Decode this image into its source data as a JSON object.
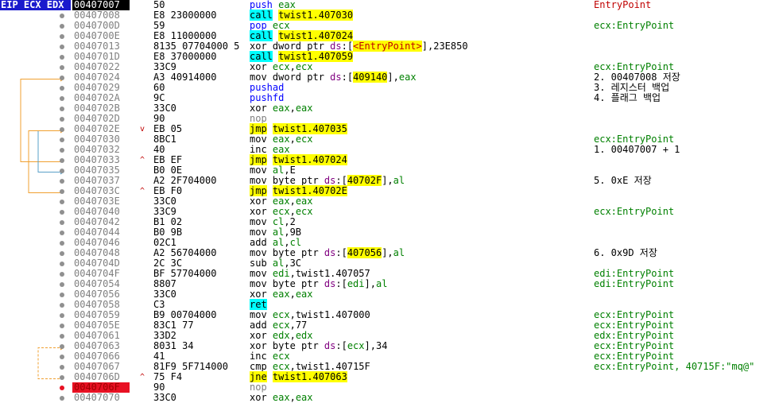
{
  "registers_label": "EIP ECX EDX",
  "colors": {
    "call_bg": "#00ffff",
    "jmp_bg": "#ffff00",
    "cur_reg_bg": "#1a1acd",
    "breakpoint": "#e81123",
    "reg_text": "#008000",
    "seg_text": "#800080",
    "jump_line": "#f0a030",
    "jump_line_sel": "#5aa0c8"
  },
  "rows": [
    {
      "addr": "00407007",
      "bytes": "50",
      "mark": "",
      "dot": false,
      "cur": true,
      "bp": false,
      "asm": [
        [
          "mn-push",
          "push "
        ],
        [
          "reg",
          "eax"
        ]
      ],
      "cmt": [
        [
          "p",
          "EntryPoint"
        ]
      ]
    },
    {
      "addr": "00407008",
      "bytes": "E8 23000000",
      "mark": "",
      "dot": true,
      "asm": [
        [
          "mn-call",
          "call"
        ],
        [
          "kw",
          " "
        ],
        [
          "mn-jmp",
          "twist1.407030"
        ]
      ],
      "cmt": []
    },
    {
      "addr": "0040700D",
      "bytes": "59",
      "mark": "",
      "dot": true,
      "asm": [
        [
          "mn-pop",
          "pop "
        ],
        [
          "reg",
          "ecx"
        ]
      ],
      "cmt": [
        [
          "r",
          "ecx:EntryPoint"
        ]
      ]
    },
    {
      "addr": "0040700E",
      "bytes": "E8 11000000",
      "mark": "",
      "dot": true,
      "asm": [
        [
          "mn-call",
          "call"
        ],
        [
          "kw",
          " "
        ],
        [
          "mn-jmp",
          "twist1.407024"
        ]
      ],
      "cmt": []
    },
    {
      "addr": "00407013",
      "bytes": "8135 07704000 5",
      "mark": "",
      "dot": true,
      "asm": [
        [
          "kw",
          "xor dword ptr "
        ],
        [
          "seg",
          "ds"
        ],
        [
          "kw",
          ":["
        ],
        [
          "lbl",
          "<EntryPoint>"
        ],
        [
          "kw",
          "],23E850"
        ]
      ],
      "cmt": []
    },
    {
      "addr": "0040701D",
      "bytes": "E8 37000000",
      "mark": "",
      "dot": true,
      "asm": [
        [
          "mn-call",
          "call"
        ],
        [
          "kw",
          " "
        ],
        [
          "mn-jmp",
          "twist1.407059"
        ]
      ],
      "cmt": []
    },
    {
      "addr": "00407022",
      "bytes": "33C9",
      "mark": "",
      "dot": true,
      "asm": [
        [
          "kw",
          "xor "
        ],
        [
          "reg",
          "ecx"
        ],
        [
          "kw",
          ","
        ],
        [
          "reg",
          "ecx"
        ]
      ],
      "cmt": [
        [
          "r",
          "ecx:EntryPoint"
        ]
      ]
    },
    {
      "addr": "00407024",
      "bytes": "A3 40914000",
      "mark": "",
      "dot": true,
      "asm": [
        [
          "kw",
          "mov dword ptr "
        ],
        [
          "seg",
          "ds"
        ],
        [
          "kw",
          ":["
        ],
        [
          "mem",
          "409140"
        ],
        [
          "kw",
          "],"
        ],
        [
          "reg",
          "eax"
        ]
      ],
      "cmt": [
        [
          "kr",
          "2. 00407008 저장"
        ]
      ]
    },
    {
      "addr": "00407029",
      "bytes": "60",
      "mark": "",
      "dot": true,
      "asm": [
        [
          "mn-push",
          "pushad"
        ]
      ],
      "cmt": [
        [
          "kr",
          "3. 레지스터 백업"
        ]
      ]
    },
    {
      "addr": "0040702A",
      "bytes": "9C",
      "mark": "",
      "dot": true,
      "asm": [
        [
          "mn-push",
          "pushfd"
        ]
      ],
      "cmt": [
        [
          "kr",
          "4. 플래그 백업"
        ]
      ]
    },
    {
      "addr": "0040702B",
      "bytes": "33C0",
      "mark": "",
      "dot": true,
      "asm": [
        [
          "kw",
          "xor "
        ],
        [
          "reg",
          "eax"
        ],
        [
          "kw",
          ","
        ],
        [
          "reg",
          "eax"
        ]
      ],
      "cmt": []
    },
    {
      "addr": "0040702D",
      "bytes": "90",
      "mark": "",
      "dot": true,
      "asm": [
        [
          "mn-nop",
          "nop"
        ]
      ],
      "cmt": []
    },
    {
      "addr": "0040702E",
      "bytes": "EB 05",
      "mark": "v",
      "dot": true,
      "asm": [
        [
          "mn-jmp",
          "jmp"
        ],
        [
          "kw",
          " "
        ],
        [
          "mn-jmp",
          "twist1.407035"
        ]
      ],
      "cmt": []
    },
    {
      "addr": "00407030",
      "bytes": "8BC1",
      "mark": "",
      "dot": true,
      "asm": [
        [
          "kw",
          "mov "
        ],
        [
          "reg",
          "eax"
        ],
        [
          "kw",
          ","
        ],
        [
          "reg",
          "ecx"
        ]
      ],
      "cmt": [
        [
          "r",
          "ecx:EntryPoint"
        ]
      ]
    },
    {
      "addr": "00407032",
      "bytes": "40",
      "mark": "",
      "dot": true,
      "asm": [
        [
          "kw",
          "inc "
        ],
        [
          "reg",
          "eax"
        ]
      ],
      "cmt": [
        [
          "kr",
          "1. 00407007 + 1"
        ]
      ]
    },
    {
      "addr": "00407033",
      "bytes": "EB EF",
      "mark": "^",
      "dot": true,
      "asm": [
        [
          "mn-jmp",
          "jmp"
        ],
        [
          "kw",
          " "
        ],
        [
          "mn-jmp",
          "twist1.407024"
        ]
      ],
      "cmt": []
    },
    {
      "addr": "00407035",
      "bytes": "B0 0E",
      "mark": "",
      "dot": true,
      "asm": [
        [
          "kw",
          "mov "
        ],
        [
          "reg",
          "al"
        ],
        [
          "kw",
          ",E"
        ]
      ],
      "cmt": []
    },
    {
      "addr": "00407037",
      "bytes": "A2 2F704000",
      "mark": "",
      "dot": true,
      "asm": [
        [
          "kw",
          "mov byte ptr "
        ],
        [
          "seg",
          "ds"
        ],
        [
          "kw",
          ":["
        ],
        [
          "mem",
          "40702F"
        ],
        [
          "kw",
          "],"
        ],
        [
          "reg",
          "al"
        ]
      ],
      "cmt": [
        [
          "kr",
          "5. 0xE 저장"
        ]
      ]
    },
    {
      "addr": "0040703C",
      "bytes": "EB F0",
      "mark": "^",
      "dot": true,
      "asm": [
        [
          "mn-jmp",
          "jmp"
        ],
        [
          "kw",
          " "
        ],
        [
          "mn-jmp",
          "twist1.40702E"
        ]
      ],
      "cmt": []
    },
    {
      "addr": "0040703E",
      "bytes": "33C0",
      "mark": "",
      "dot": true,
      "asm": [
        [
          "kw",
          "xor "
        ],
        [
          "reg",
          "eax"
        ],
        [
          "kw",
          ","
        ],
        [
          "reg",
          "eax"
        ]
      ],
      "cmt": []
    },
    {
      "addr": "00407040",
      "bytes": "33C9",
      "mark": "",
      "dot": true,
      "asm": [
        [
          "kw",
          "xor "
        ],
        [
          "reg",
          "ecx"
        ],
        [
          "kw",
          ","
        ],
        [
          "reg",
          "ecx"
        ]
      ],
      "cmt": [
        [
          "r",
          "ecx:EntryPoint"
        ]
      ]
    },
    {
      "addr": "00407042",
      "bytes": "B1 02",
      "mark": "",
      "dot": true,
      "asm": [
        [
          "kw",
          "mov "
        ],
        [
          "reg",
          "cl"
        ],
        [
          "kw",
          ",2"
        ]
      ],
      "cmt": []
    },
    {
      "addr": "00407044",
      "bytes": "B0 9B",
      "mark": "",
      "dot": true,
      "asm": [
        [
          "kw",
          "mov "
        ],
        [
          "reg",
          "al"
        ],
        [
          "kw",
          ",9B"
        ]
      ],
      "cmt": []
    },
    {
      "addr": "00407046",
      "bytes": "02C1",
      "mark": "",
      "dot": true,
      "asm": [
        [
          "kw",
          "add "
        ],
        [
          "reg",
          "al"
        ],
        [
          "kw",
          ","
        ],
        [
          "reg",
          "cl"
        ]
      ],
      "cmt": []
    },
    {
      "addr": "00407048",
      "bytes": "A2 56704000",
      "mark": "",
      "dot": true,
      "asm": [
        [
          "kw",
          "mov byte ptr "
        ],
        [
          "seg",
          "ds"
        ],
        [
          "kw",
          ":["
        ],
        [
          "mem",
          "407056"
        ],
        [
          "kw",
          "],"
        ],
        [
          "reg",
          "al"
        ]
      ],
      "cmt": [
        [
          "kr",
          "6. 0x9D 저장"
        ]
      ]
    },
    {
      "addr": "0040704D",
      "bytes": "2C 3C",
      "mark": "",
      "dot": true,
      "asm": [
        [
          "kw",
          "sub "
        ],
        [
          "reg",
          "al"
        ],
        [
          "kw",
          ",3C"
        ]
      ],
      "cmt": []
    },
    {
      "addr": "0040704F",
      "bytes": "BF 57704000",
      "mark": "",
      "dot": true,
      "asm": [
        [
          "kw",
          "mov "
        ],
        [
          "reg",
          "edi"
        ],
        [
          "kw",
          ",twist1.407057"
        ]
      ],
      "cmt": [
        [
          "r",
          "edi:EntryPoint"
        ]
      ]
    },
    {
      "addr": "00407054",
      "bytes": "8807",
      "mark": "",
      "dot": true,
      "asm": [
        [
          "kw",
          "mov byte ptr "
        ],
        [
          "seg",
          "ds"
        ],
        [
          "kw",
          ":["
        ],
        [
          "reg",
          "edi"
        ],
        [
          "kw",
          "],"
        ],
        [
          "reg",
          "al"
        ]
      ],
      "cmt": [
        [
          "r",
          "edi:EntryPoint"
        ]
      ]
    },
    {
      "addr": "00407056",
      "bytes": "33C0",
      "mark": "",
      "dot": true,
      "asm": [
        [
          "kw",
          "xor "
        ],
        [
          "reg",
          "eax"
        ],
        [
          "kw",
          ","
        ],
        [
          "reg",
          "eax"
        ]
      ],
      "cmt": []
    },
    {
      "addr": "00407058",
      "bytes": "C3",
      "mark": "",
      "dot": true,
      "asm": [
        [
          "mn-ret",
          "ret"
        ]
      ],
      "cmt": []
    },
    {
      "addr": "00407059",
      "bytes": "B9 00704000",
      "mark": "",
      "dot": true,
      "asm": [
        [
          "kw",
          "mov "
        ],
        [
          "reg",
          "ecx"
        ],
        [
          "kw",
          ",twist1.407000"
        ]
      ],
      "cmt": [
        [
          "r",
          "ecx:EntryPoint"
        ]
      ]
    },
    {
      "addr": "0040705E",
      "bytes": "83C1 77",
      "mark": "",
      "dot": true,
      "asm": [
        [
          "kw",
          "add "
        ],
        [
          "reg",
          "ecx"
        ],
        [
          "kw",
          ",77"
        ]
      ],
      "cmt": [
        [
          "r",
          "ecx:EntryPoint"
        ]
      ]
    },
    {
      "addr": "00407061",
      "bytes": "33D2",
      "mark": "",
      "dot": true,
      "asm": [
        [
          "kw",
          "xor "
        ],
        [
          "reg",
          "edx"
        ],
        [
          "kw",
          ","
        ],
        [
          "reg",
          "edx"
        ]
      ],
      "cmt": [
        [
          "r",
          "edx:EntryPoint"
        ]
      ]
    },
    {
      "addr": "00407063",
      "bytes": "8031 34",
      "mark": "",
      "dot": true,
      "asm": [
        [
          "kw",
          "xor byte ptr "
        ],
        [
          "seg",
          "ds"
        ],
        [
          "kw",
          ":["
        ],
        [
          "reg",
          "ecx"
        ],
        [
          "kw",
          "],34"
        ]
      ],
      "cmt": [
        [
          "r",
          "ecx:EntryPoint"
        ]
      ]
    },
    {
      "addr": "00407066",
      "bytes": "41",
      "mark": "",
      "dot": true,
      "asm": [
        [
          "kw",
          "inc "
        ],
        [
          "reg",
          "ecx"
        ]
      ],
      "cmt": [
        [
          "r",
          "ecx:EntryPoint"
        ]
      ]
    },
    {
      "addr": "00407067",
      "bytes": "81F9 5F714000",
      "mark": "",
      "dot": true,
      "asm": [
        [
          "kw",
          "cmp "
        ],
        [
          "reg",
          "ecx"
        ],
        [
          "kw",
          ",twist1.40715F"
        ]
      ],
      "cmt": [
        [
          "r",
          "ecx:EntryPoint, 40715F:\"mq@\""
        ]
      ]
    },
    {
      "addr": "0040706D",
      "bytes": "75 F4",
      "mark": "^",
      "dot": true,
      "asm": [
        [
          "mn-jmp",
          "jne"
        ],
        [
          "kw",
          " "
        ],
        [
          "mn-jmp",
          "twist1.407063"
        ]
      ],
      "cmt": []
    },
    {
      "addr": "0040706F",
      "bytes": "90",
      "mark": "",
      "dot": true,
      "bp": true,
      "asm": [
        [
          "mn-nop",
          "nop"
        ]
      ],
      "cmt": []
    },
    {
      "addr": "00407070",
      "bytes": "33C0",
      "mark": "",
      "dot": true,
      "asm": [
        [
          "kw",
          "xor "
        ],
        [
          "reg",
          "eax"
        ],
        [
          "kw",
          ","
        ],
        [
          "reg",
          "eax"
        ]
      ],
      "cmt": []
    }
  ]
}
